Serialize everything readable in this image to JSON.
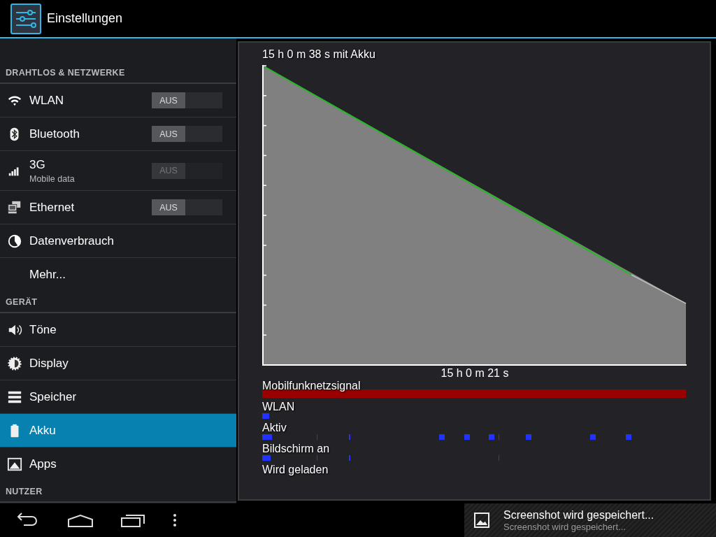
{
  "action_bar": {
    "title": "Einstellungen"
  },
  "sidebar": {
    "sections": [
      {
        "header": "DRAHTLOS & NETZWERKE",
        "items": [
          {
            "kind": "toggle",
            "label": "WLAN",
            "selected": false,
            "switch": {
              "label": "AUS",
              "on": false,
              "disabled": false
            }
          },
          {
            "kind": "toggle",
            "label": "Bluetooth",
            "selected": false,
            "switch": {
              "label": "AUS",
              "on": false,
              "disabled": false
            }
          },
          {
            "kind": "toggle",
            "label": "3G",
            "subtitle": "Mobile data",
            "selected": false,
            "switch": {
              "label": "AUS",
              "on": false,
              "disabled": true
            }
          },
          {
            "kind": "toggle",
            "label": "Ethernet",
            "selected": false,
            "switch": {
              "label": "AUS",
              "on": false,
              "disabled": false
            }
          },
          {
            "kind": "plain",
            "label": "Datenverbrauch",
            "selected": false
          },
          {
            "kind": "plain",
            "label": "Mehr...",
            "selected": false
          }
        ]
      },
      {
        "header": "GERÄT",
        "items": [
          {
            "kind": "plain",
            "label": "Töne",
            "selected": false
          },
          {
            "kind": "plain",
            "label": "Display",
            "selected": false
          },
          {
            "kind": "plain",
            "label": "Speicher",
            "selected": false
          },
          {
            "kind": "plain",
            "label": "Akku",
            "selected": true
          },
          {
            "kind": "plain",
            "label": "Apps",
            "selected": false
          }
        ]
      },
      {
        "header": "NUTZER"
      }
    ]
  },
  "battery_panel": {
    "title": "15 h 0 m 38 s mit Akku",
    "duration": "15 h 0 m 21 s",
    "tracks": [
      {
        "label": "Mobilfunknetzsignal"
      },
      {
        "label": "WLAN"
      },
      {
        "label": "Aktiv"
      },
      {
        "label": "Bildschirm an"
      },
      {
        "label": "Wird geladen"
      }
    ]
  },
  "notification": {
    "title": "Screenshot wird gespeichert...",
    "text": "Screenshot wird gespeichert..."
  }
}
